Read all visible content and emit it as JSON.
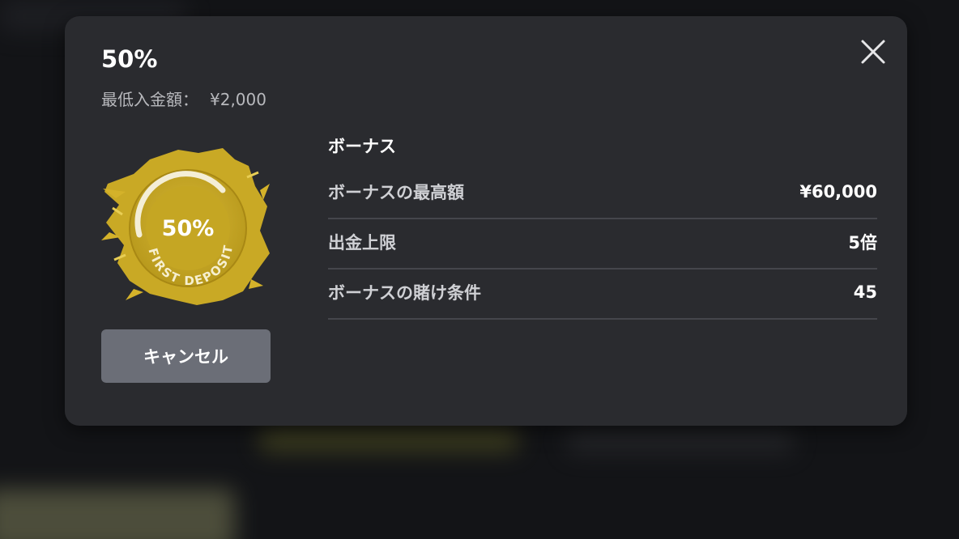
{
  "modal": {
    "title": "50%",
    "min_deposit_label": "最低入金額：",
    "min_deposit_value": "¥2,000",
    "close_icon": "close-icon",
    "cancel_label": "キャンセル"
  },
  "badge": {
    "percent": "50%",
    "caption": "FIRST DEPOSIT",
    "color": "#d9b82a"
  },
  "details": {
    "heading": "ボーナス",
    "rows": [
      {
        "label": "ボーナスの最高額",
        "value": "¥60,000"
      },
      {
        "label": "出金上限",
        "value": "5倍"
      },
      {
        "label": "ボーナスの賭け条件",
        "value": "45"
      }
    ]
  }
}
